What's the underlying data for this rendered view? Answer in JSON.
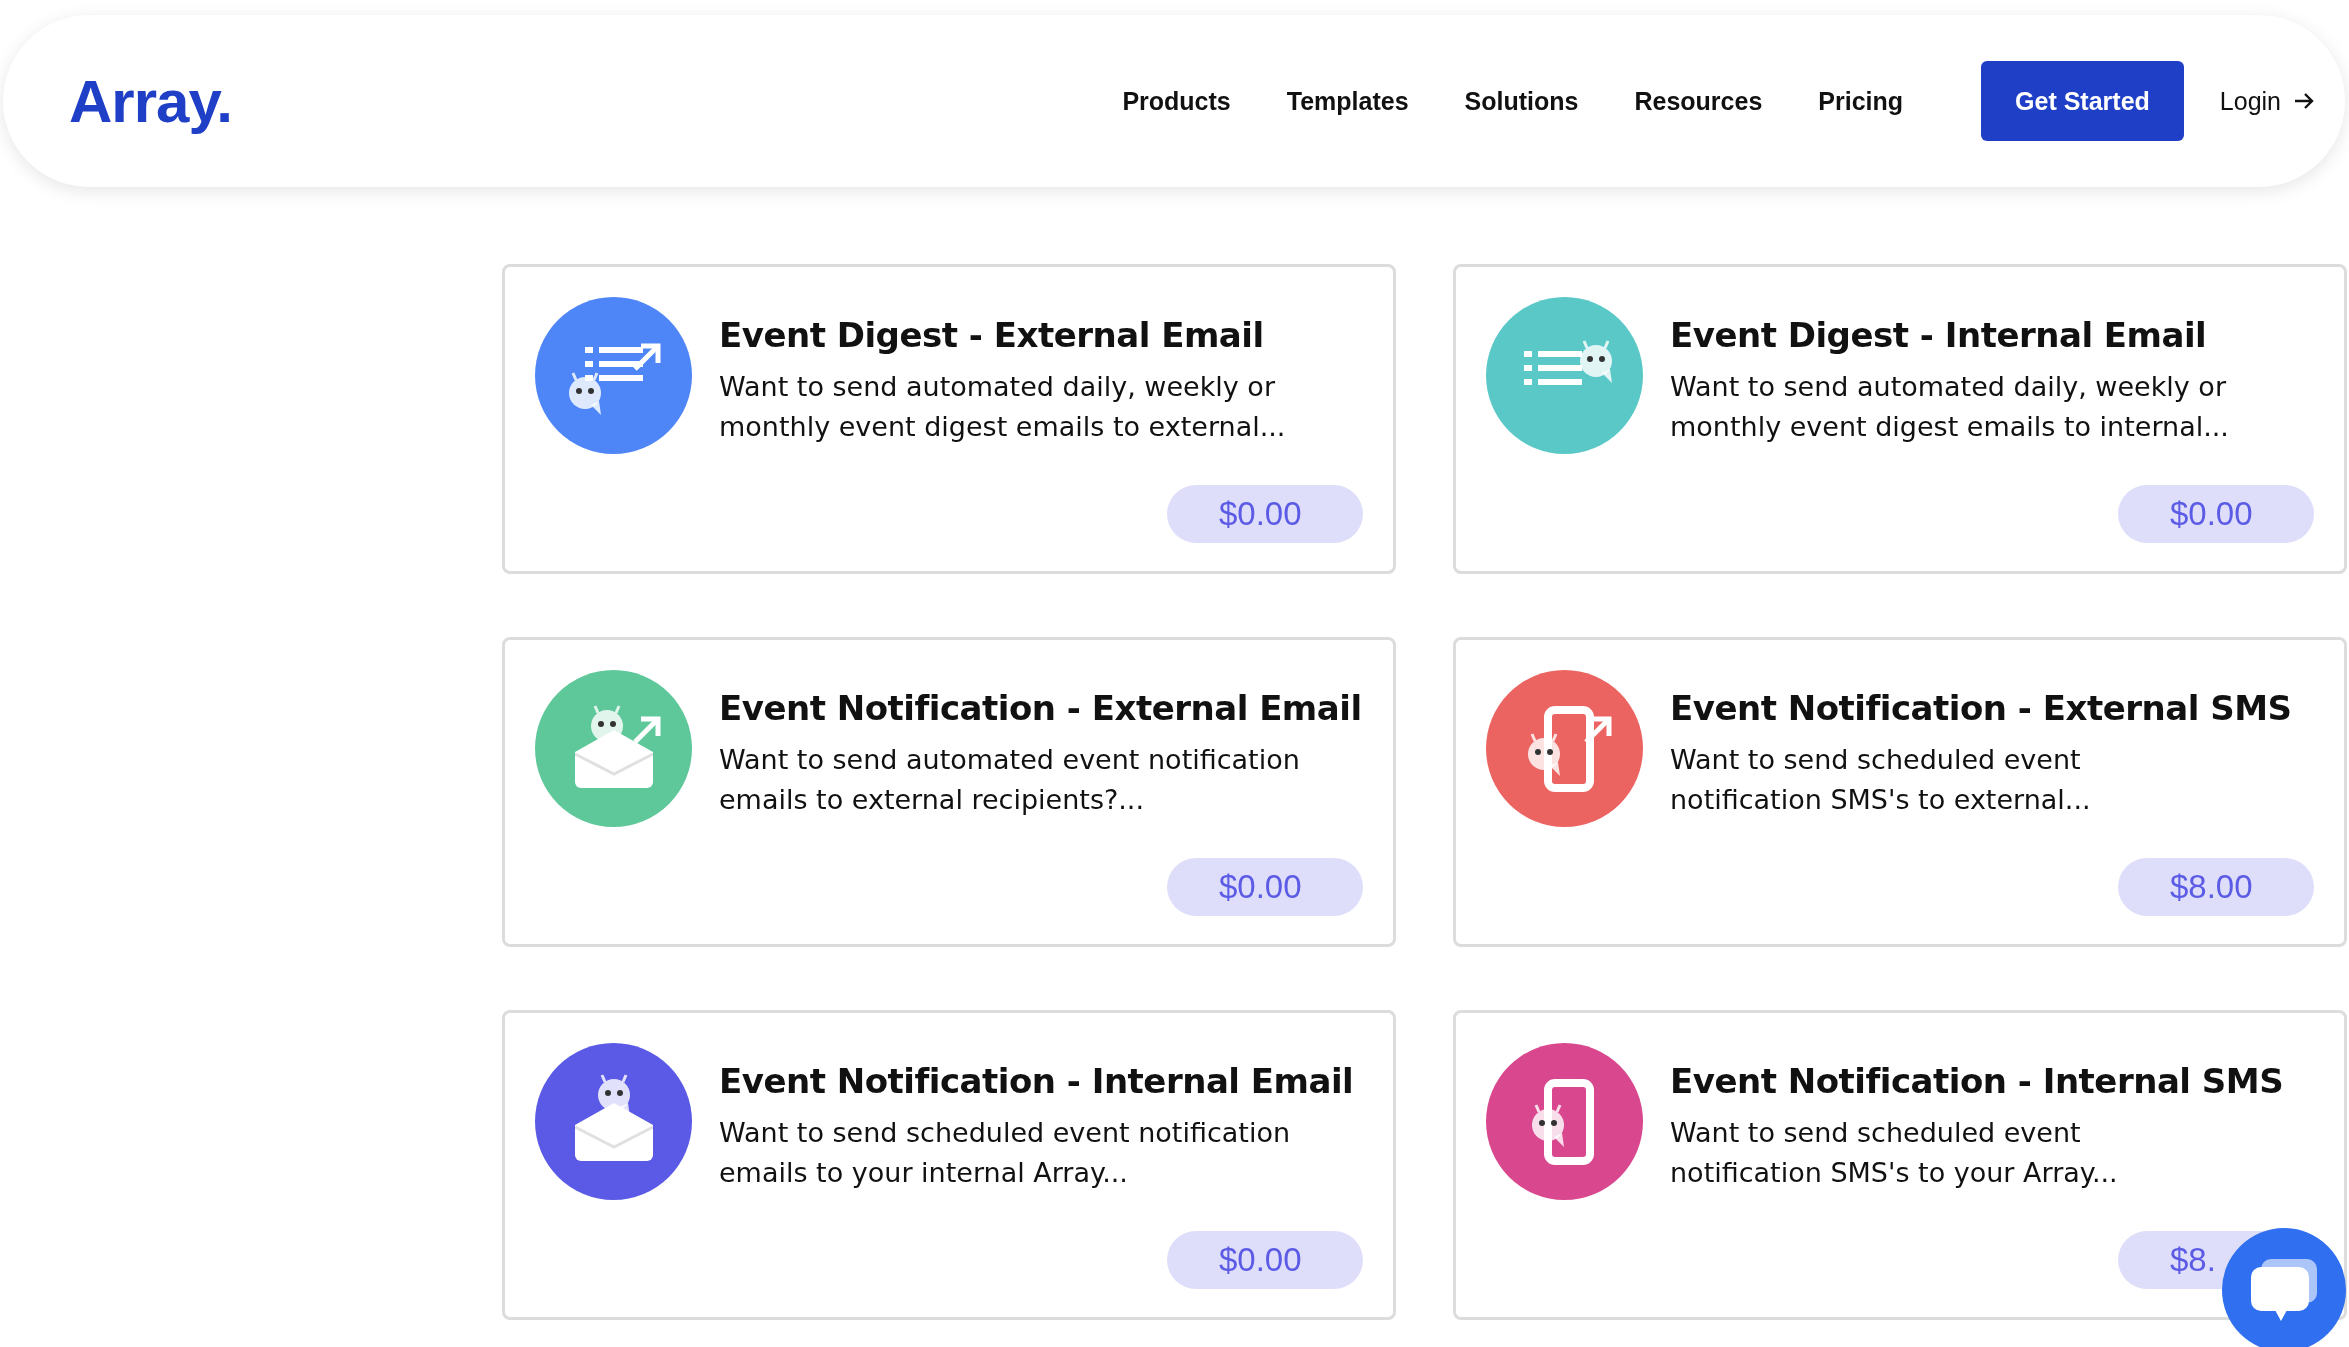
{
  "header": {
    "logo": "Array.",
    "nav": [
      "Products",
      "Templates",
      "Solutions",
      "Resources",
      "Pricing"
    ],
    "cta": "Get Started",
    "login": "Login"
  },
  "cards": [
    {
      "title": "Event Digest - External Email",
      "description": "Want to send automated daily, weekly or\nmonthly event digest emails to external...",
      "price": "$0.00",
      "kind": "list-arrow",
      "color": "#4f86f7"
    },
    {
      "title": "Event Digest - Internal Email",
      "description": "Want to send automated daily, weekly or\nmonthly event digest emails to internal...",
      "price": "$0.00",
      "kind": "list",
      "color": "#5bc8c8"
    },
    {
      "title": "Event Notification - External Email",
      "description": "Want to send automated event notification\nemails to external recipients?...",
      "price": "$0.00",
      "kind": "envelope-arrow",
      "color": "#5ec89a"
    },
    {
      "title": "Event Notification - External SMS",
      "description": "Want to send scheduled event\nnotification SMS's to external...",
      "price": "$8.00",
      "kind": "phone-arrow",
      "color": "#ec6461"
    },
    {
      "title": "Event Notification - Internal Email",
      "description": "Want to send scheduled event notification\nemails to your internal Array...",
      "price": "$0.00",
      "kind": "envelope",
      "color": "#5a5ae6"
    },
    {
      "title": "Event Notification - Internal SMS",
      "description": "Want to send scheduled event\nnotification SMS's to your Array...",
      "price": "$8.",
      "kind": "phone",
      "color": "#d9478f"
    }
  ]
}
